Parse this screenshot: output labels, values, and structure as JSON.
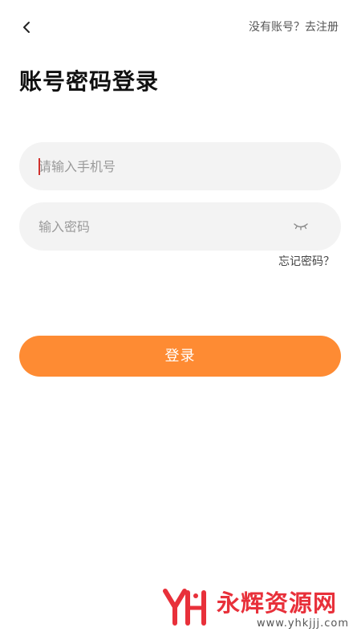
{
  "header": {
    "back_icon": "chevron-left-icon",
    "register_link": "没有账号？去注册"
  },
  "title": "账号密码登录",
  "phone_input": {
    "placeholder": "请输入手机号",
    "value": ""
  },
  "password_input": {
    "placeholder": "输入密码",
    "value": "",
    "toggle_icon": "eye-closed-icon"
  },
  "forgot_password": "忘记密码？",
  "login_button": "登录",
  "watermark": {
    "name": "永辉资源网",
    "url": "www.yhkjjj.com"
  },
  "colors": {
    "accent": "#fe8b33",
    "field_background": "#f3f3f3",
    "caret": "#d0312d",
    "watermark": "#e8303a"
  }
}
